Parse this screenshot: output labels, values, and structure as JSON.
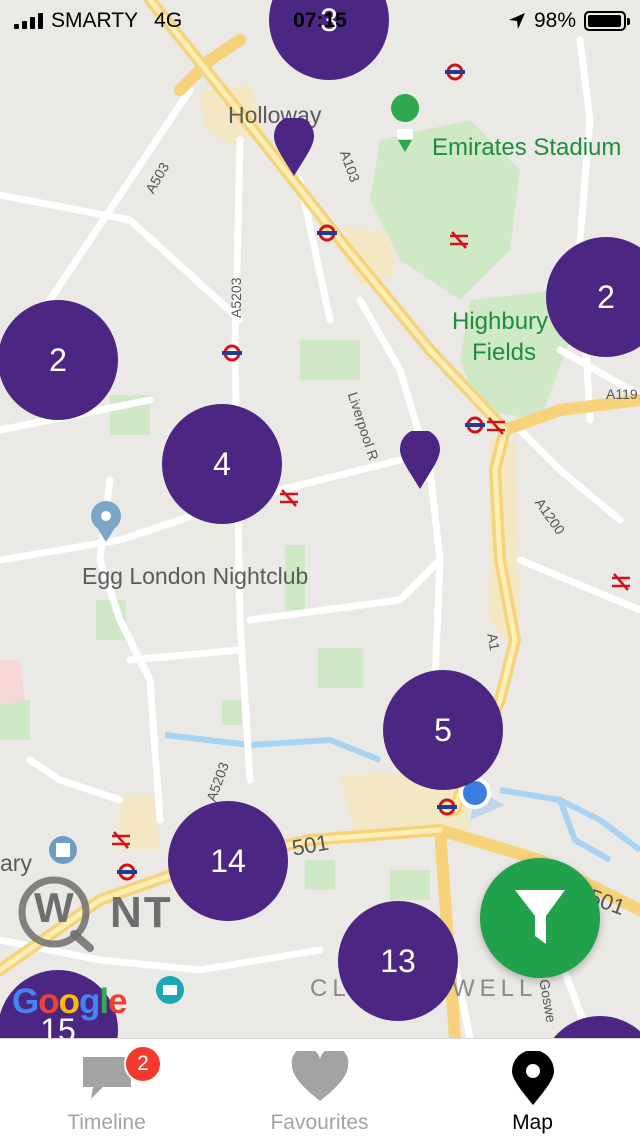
{
  "status": {
    "carrier": "SMARTY",
    "network": "4G",
    "time": "07:15",
    "battery": "98%",
    "battery_level": 0.98
  },
  "map": {
    "labels": {
      "holloway": "Holloway",
      "emirates": "Emirates Stadium",
      "highbury1": "Highbury",
      "highbury2": "Fields",
      "egg": "Egg London Nightclub",
      "clerkenwell": "CL",
      "clerkenwell2": "WELL",
      "ary": "ary",
      "liverpool": "Liverpool R",
      "a503": "A503",
      "a103": "A103",
      "a5203": "A5203",
      "a5203b": "A5203",
      "a1200": "A1200",
      "a1": "A1",
      "a501": "501",
      "a501b": "501",
      "a119": "A119",
      "goswell": "Goswe"
    },
    "clusters": [
      {
        "count": "3"
      },
      {
        "count": "2"
      },
      {
        "count": "2"
      },
      {
        "count": "4"
      },
      {
        "count": "5"
      },
      {
        "count": "14"
      },
      {
        "count": "13"
      },
      {
        "count": "15"
      },
      {
        "count": ""
      }
    ]
  },
  "watermark": {
    "letter": "W",
    "text": "NT"
  },
  "google_logo": {
    "text": "Google"
  },
  "filter_button": {
    "icon": "filter-icon",
    "color": "#20a24b"
  },
  "cluster_color": "#4b2683",
  "tabs": [
    {
      "label": "Timeline",
      "icon": "chat-bubble-icon",
      "badge": "2"
    },
    {
      "label": "Favourites",
      "icon": "heart-icon"
    },
    {
      "label": "Map",
      "icon": "map-pin-icon"
    }
  ]
}
